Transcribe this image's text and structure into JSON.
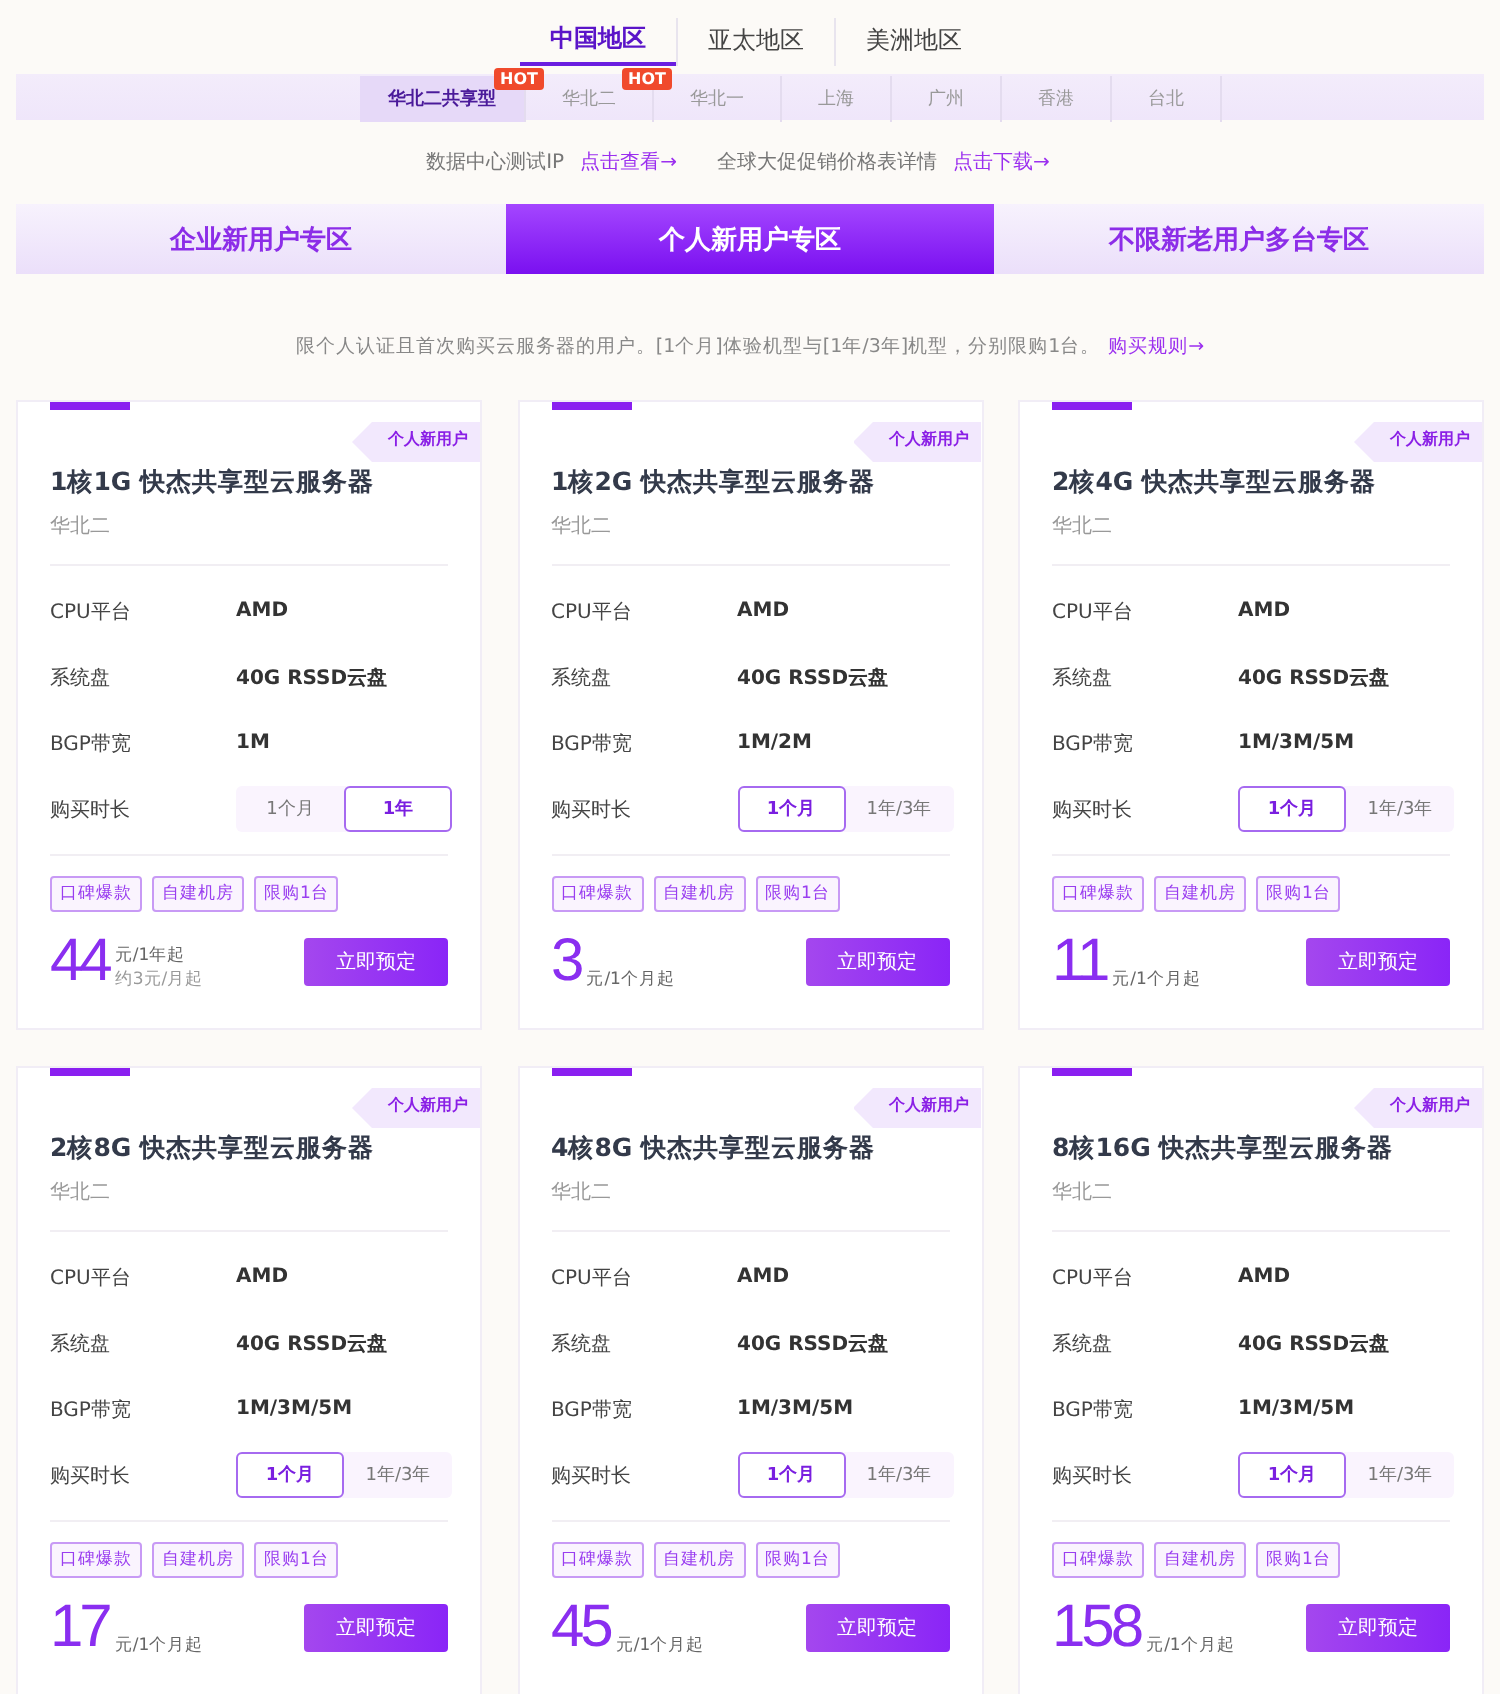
{
  "regions": [
    {
      "label": "中国地区",
      "selected": true
    },
    {
      "label": "亚太地区",
      "selected": false
    },
    {
      "label": "美洲地区",
      "selected": false
    }
  ],
  "zones": [
    {
      "label": "华北二共享型",
      "selected": true,
      "badge": "HOT"
    },
    {
      "label": "华北二",
      "selected": false,
      "badge": "HOT"
    },
    {
      "label": "华北一",
      "selected": false
    },
    {
      "label": "上海",
      "selected": false
    },
    {
      "label": "广州",
      "selected": false
    },
    {
      "label": "香港",
      "selected": false
    },
    {
      "label": "台北",
      "selected": false
    }
  ],
  "links": [
    {
      "text": "数据中心测试IP",
      "link": "点击查看→"
    },
    {
      "text": "全球大促促销价格表详情",
      "link": "点击下载→"
    }
  ],
  "categories": [
    {
      "label": "企业新用户专区",
      "selected": false
    },
    {
      "label": "个人新用户专区",
      "selected": true
    },
    {
      "label": "不限新老用户多台专区",
      "selected": false
    }
  ],
  "description": {
    "text": "限个人认证且首次购买云服务器的用户。[1个月]体验机型与[1年/3年]机型，分别限购1台。",
    "link": "购买规则→"
  },
  "cards": [
    {
      "badge": "个人新用户",
      "title": "1核1G 快杰共享型云服务器",
      "region": "华北二",
      "specs": [
        {
          "label": "CPU平台",
          "value": "AMD"
        },
        {
          "label": "系统盘",
          "value": "40G RSSD云盘"
        },
        {
          "label": "BGP带宽",
          "value": "1M"
        }
      ],
      "duration_label": "购买时长",
      "durations": [
        {
          "label": "1个月",
          "selected": false
        },
        {
          "label": "1年",
          "selected": true
        }
      ],
      "tags": [
        "口碑爆款",
        "自建机房",
        "限购1台"
      ],
      "price": "44",
      "unit": "元/1年起",
      "note": "约3元/月起",
      "button": "立即预定"
    },
    {
      "badge": "个人新用户",
      "title": "1核2G 快杰共享型云服务器",
      "region": "华北二",
      "specs": [
        {
          "label": "CPU平台",
          "value": "AMD"
        },
        {
          "label": "系统盘",
          "value": "40G RSSD云盘"
        },
        {
          "label": "BGP带宽",
          "value": "1M/2M"
        }
      ],
      "duration_label": "购买时长",
      "durations": [
        {
          "label": "1个月",
          "selected": true
        },
        {
          "label": "1年/3年",
          "selected": false
        }
      ],
      "tags": [
        "口碑爆款",
        "自建机房",
        "限购1台"
      ],
      "price": "3",
      "unit": "元/1个月起",
      "button": "立即预定"
    },
    {
      "badge": "个人新用户",
      "title": "2核4G 快杰共享型云服务器",
      "region": "华北二",
      "specs": [
        {
          "label": "CPU平台",
          "value": "AMD"
        },
        {
          "label": "系统盘",
          "value": "40G RSSD云盘"
        },
        {
          "label": "BGP带宽",
          "value": "1M/3M/5M"
        }
      ],
      "duration_label": "购买时长",
      "durations": [
        {
          "label": "1个月",
          "selected": true
        },
        {
          "label": "1年/3年",
          "selected": false
        }
      ],
      "tags": [
        "口碑爆款",
        "自建机房",
        "限购1台"
      ],
      "price": "11",
      "unit": "元/1个月起",
      "button": "立即预定"
    },
    {
      "badge": "个人新用户",
      "title": "2核8G 快杰共享型云服务器",
      "region": "华北二",
      "specs": [
        {
          "label": "CPU平台",
          "value": "AMD"
        },
        {
          "label": "系统盘",
          "value": "40G RSSD云盘"
        },
        {
          "label": "BGP带宽",
          "value": "1M/3M/5M"
        }
      ],
      "duration_label": "购买时长",
      "durations": [
        {
          "label": "1个月",
          "selected": true
        },
        {
          "label": "1年/3年",
          "selected": false
        }
      ],
      "tags": [
        "口碑爆款",
        "自建机房",
        "限购1台"
      ],
      "price": "17",
      "unit": "元/1个月起",
      "button": "立即预定"
    },
    {
      "badge": "个人新用户",
      "title": "4核8G 快杰共享型云服务器",
      "region": "华北二",
      "specs": [
        {
          "label": "CPU平台",
          "value": "AMD"
        },
        {
          "label": "系统盘",
          "value": "40G RSSD云盘"
        },
        {
          "label": "BGP带宽",
          "value": "1M/3M/5M"
        }
      ],
      "duration_label": "购买时长",
      "durations": [
        {
          "label": "1个月",
          "selected": true
        },
        {
          "label": "1年/3年",
          "selected": false
        }
      ],
      "tags": [
        "口碑爆款",
        "自建机房",
        "限购1台"
      ],
      "price": "45",
      "unit": "元/1个月起",
      "button": "立即预定"
    },
    {
      "badge": "个人新用户",
      "title": "8核16G 快杰共享型云服务器",
      "region": "华北二",
      "specs": [
        {
          "label": "CPU平台",
          "value": "AMD"
        },
        {
          "label": "系统盘",
          "value": "40G RSSD云盘"
        },
        {
          "label": "BGP带宽",
          "value": "1M/3M/5M"
        }
      ],
      "duration_label": "购买时长",
      "durations": [
        {
          "label": "1个月",
          "selected": true
        },
        {
          "label": "1年/3年",
          "selected": false
        }
      ],
      "tags": [
        "口碑爆款",
        "自建机房",
        "限购1台"
      ],
      "price": "158",
      "unit": "元/1个月起",
      "button": "立即预定"
    }
  ]
}
